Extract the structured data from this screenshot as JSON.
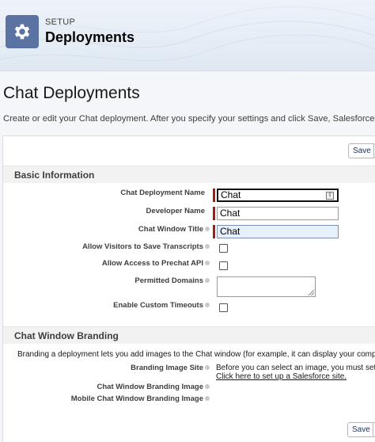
{
  "header": {
    "eyebrow": "SETUP",
    "title": "Deployments",
    "icon": "gear-icon"
  },
  "page": {
    "title": "Chat Deployments",
    "description": "Create or edit your Chat deployment. After you specify your settings and click Save, Salesforce gen"
  },
  "buttons": {
    "save_top": "Save",
    "save_bottom": "Save"
  },
  "basic_info": {
    "section_title": "Basic Information",
    "fields": {
      "deployment_name_label": "Chat Deployment Name",
      "deployment_name_value": "Chat",
      "developer_name_label": "Developer Name",
      "developer_name_value": "Chat",
      "window_title_label": "Chat Window Title",
      "window_title_value": "Chat",
      "allow_transcripts_label": "Allow Visitors to Save Transcripts",
      "allow_transcripts_checked": false,
      "allow_prechat_label": "Allow Access to Prechat API",
      "allow_prechat_checked": false,
      "permitted_domains_label": "Permitted Domains",
      "permitted_domains_value": "",
      "custom_timeouts_label": "Enable Custom Timeouts",
      "custom_timeouts_checked": false
    }
  },
  "branding": {
    "section_title": "Chat Window Branding",
    "description": "Branding a deployment lets you add images to the Chat window (for example, it can display your compa",
    "branding_site_label": "Branding Image Site",
    "branding_site_text": "Before you can select an image, you must set",
    "branding_site_link": "Click here to set up a Salesforce site.",
    "window_image_label": "Chat Window Branding Image",
    "mobile_image_label": "Mobile Chat Window Branding Image"
  },
  "colors": {
    "required": "#a61a14",
    "header_icon_bg": "#5a73a3",
    "section_bg": "#f3f2f2"
  }
}
